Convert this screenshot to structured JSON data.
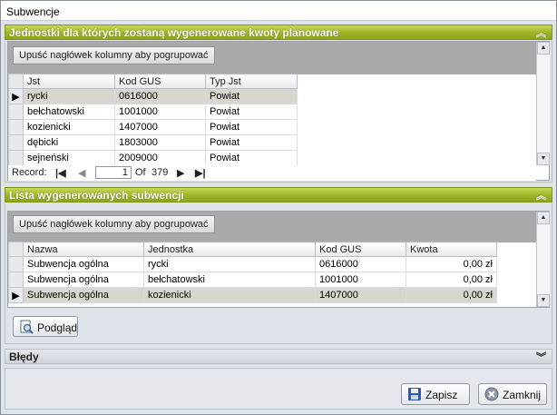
{
  "window": {
    "title": "Subwencje"
  },
  "top_panel": {
    "title": "Jednostki dla których zostaną wygenerowane kwoty planowane",
    "group_hint": "Upuść nagłówek kolumny aby pogrupować",
    "columns": [
      "Jst",
      "Kod GUS",
      "Typ Jst"
    ],
    "rows": [
      [
        "rycki",
        "0616000",
        "Powiat"
      ],
      [
        "bełchatowski",
        "1001000",
        "Powiat"
      ],
      [
        "kozienicki",
        "1407000",
        "Powiat"
      ],
      [
        "dębicki",
        "1803000",
        "Powiat"
      ],
      [
        "sejneński",
        "2009000",
        "Powiat"
      ]
    ],
    "navigator": {
      "label": "Record:",
      "current": "1",
      "of_label": "Of",
      "total": "379"
    }
  },
  "bottom_panel": {
    "title": "Lista wygenerowanych subwencji",
    "group_hint": "Upuść nagłówek kolumny aby pogrupować",
    "columns": [
      "Nazwa",
      "Jednostka",
      "Kod GUS",
      "Kwota"
    ],
    "rows": [
      [
        "Subwencja ogólna",
        "rycki",
        "0616000",
        "0,00 zł"
      ],
      [
        "Subwencja ogólna",
        "bełchatowski",
        "1001000",
        "0,00 zł"
      ],
      [
        "Subwencja ogólna",
        "kozienicki",
        "1407000",
        "0,00 zł"
      ]
    ],
    "preview_button": "Podgląd"
  },
  "errors_panel": {
    "title": "Błędy"
  },
  "footer": {
    "save_button": "Zapisz",
    "close_button": "Zamknij"
  },
  "colors": {
    "header_accent": "#9db324",
    "selected_row": "#d9d6cf"
  },
  "icons": [
    "collapse-up-icon",
    "expand-down-icon",
    "row-pointer-icon",
    "first-record-icon",
    "prev-record-icon",
    "next-record-icon",
    "last-record-icon",
    "preview-icon",
    "save-icon",
    "close-icon"
  ]
}
